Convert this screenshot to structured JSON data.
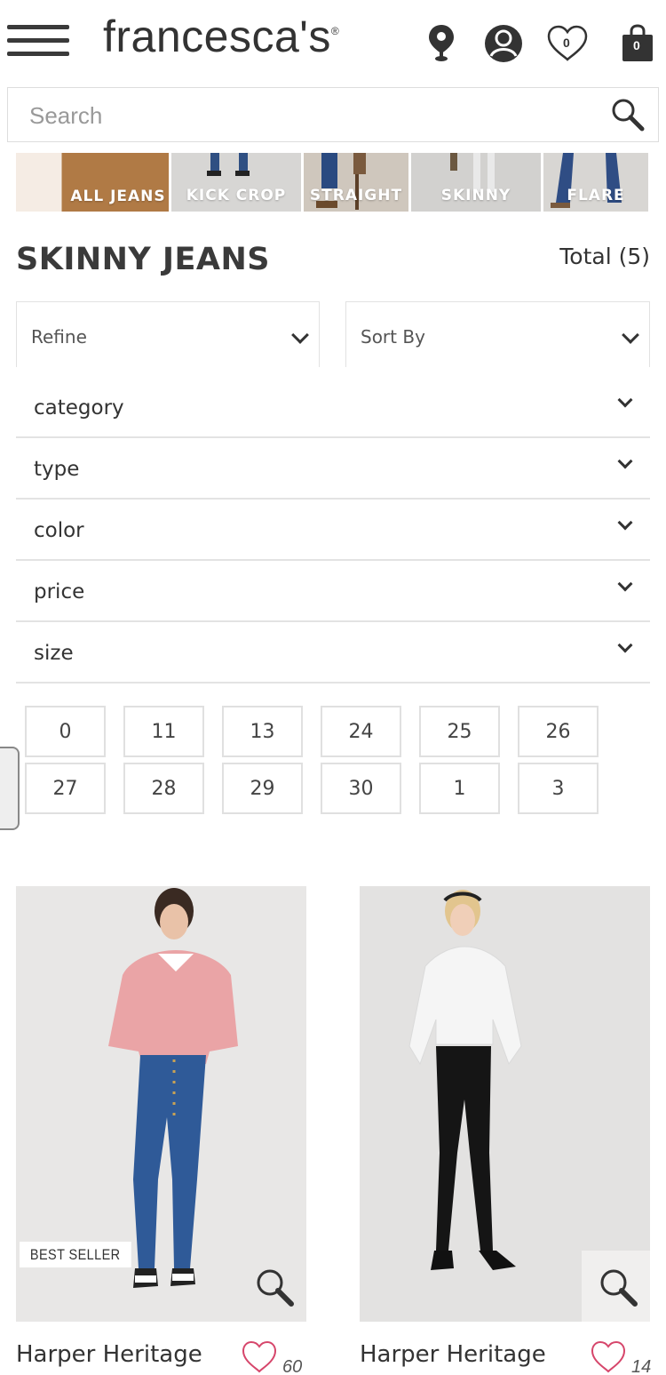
{
  "header": {
    "logo": "francesca's",
    "logo_mark": "®",
    "favorites_count": "0",
    "bag_count": "0",
    "icons": [
      "menu-icon",
      "location-pin-icon",
      "account-icon",
      "heart-icon",
      "shopping-bag-icon"
    ]
  },
  "search": {
    "placeholder": "Search",
    "icon": "search-icon"
  },
  "categories": [
    {
      "label": "ALL JEANS"
    },
    {
      "label": "KICK CROP"
    },
    {
      "label": "STRAIGHT"
    },
    {
      "label": "SKINNY"
    },
    {
      "label": "FLARE"
    }
  ],
  "page": {
    "title": "SKINNY JEANS",
    "total": "Total (5)"
  },
  "refine": {
    "label": "Refine"
  },
  "sort": {
    "label": "Sort By"
  },
  "filters": [
    {
      "label": "category"
    },
    {
      "label": "type"
    },
    {
      "label": "color"
    },
    {
      "label": "price"
    },
    {
      "label": "size"
    }
  ],
  "sizes": [
    "0",
    "11",
    "13",
    "24",
    "25",
    "26",
    "27",
    "28",
    "29",
    "30",
    "1",
    "3"
  ],
  "products": [
    {
      "name": "Harper Heritage",
      "badge": "BEST SELLER",
      "wishlist_count": "60"
    },
    {
      "name": "Harper Heritage",
      "badge": "",
      "wishlist_count": "14"
    }
  ],
  "colors": {
    "text": "#333333",
    "border": "#e2e2e2",
    "tile_brown": "#b07a45"
  }
}
